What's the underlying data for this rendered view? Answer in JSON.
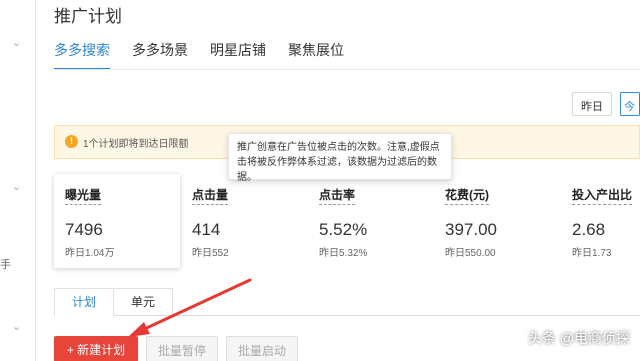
{
  "page_title": "推广计划",
  "tabs": [
    {
      "label": "多多搜索",
      "active": true
    },
    {
      "label": "多多场景",
      "active": false
    },
    {
      "label": "明星店铺",
      "active": false
    },
    {
      "label": "聚焦展位",
      "active": false
    }
  ],
  "date_buttons": {
    "yesterday": "昨日",
    "today": "今"
  },
  "warning": {
    "text": "1个计划即将到达日限额"
  },
  "tooltip": {
    "text": "推广创意在广告位被点击的次数。注意,虚假点击将被反作弊体系过滤，该数据为过滤后的数据。"
  },
  "metrics": [
    {
      "label": "曝光量",
      "value": "7496",
      "yesterday": "昨日1.04万"
    },
    {
      "label": "点击量",
      "value": "414",
      "yesterday": "昨日552"
    },
    {
      "label": "点击率",
      "value": "5.52%",
      "yesterday": "昨日5.32%"
    },
    {
      "label": "花费(元)",
      "value": "397.00",
      "yesterday": "昨日550.00"
    },
    {
      "label": "投入产出比",
      "value": "2.68",
      "yesterday": "昨日1.73"
    }
  ],
  "subtabs": [
    {
      "label": "计划",
      "active": true
    },
    {
      "label": "单元",
      "active": false
    }
  ],
  "actions": {
    "new_plan": "+ 新建计划",
    "batch_pause": "批量暂停",
    "batch_start": "批量启动"
  },
  "sidebar": {
    "cut_text": "手"
  },
  "watermark": "头条 @电商侦探",
  "colors": {
    "accent": "#2f86d6",
    "primary_button": "#e7443a",
    "warning_bg": "#fff7e6",
    "arrow": "#e53935"
  }
}
